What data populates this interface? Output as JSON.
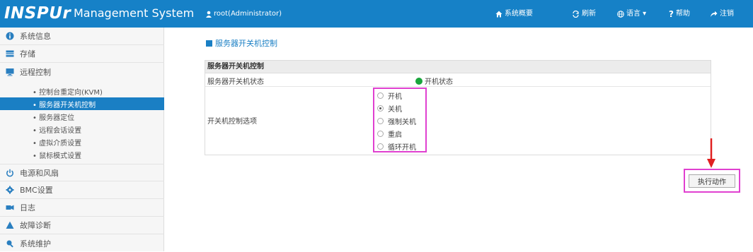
{
  "app": {
    "logo": "INSPUr",
    "title": "Management System",
    "user": "root(Administrator)"
  },
  "topnav": {
    "overview": "系统概要",
    "refresh": "刷新",
    "language": "语言 ▾",
    "help": "帮助",
    "logout": "注销"
  },
  "sidebar": {
    "items": [
      {
        "label": "系统信息",
        "icon": "info-icon"
      },
      {
        "label": "存储",
        "icon": "storage-icon"
      },
      {
        "label": "远程控制",
        "icon": "monitor-icon"
      }
    ],
    "sub_items": [
      {
        "label": "控制台重定向(KVM)",
        "active": false
      },
      {
        "label": "服务器开关机控制",
        "active": true
      },
      {
        "label": "服务器定位",
        "active": false
      },
      {
        "label": "远程会话设置",
        "active": false
      },
      {
        "label": "虚拟介质设置",
        "active": false
      },
      {
        "label": "鼠标模式设置",
        "active": false
      }
    ],
    "items_after": [
      {
        "label": "电源和风扇",
        "icon": "power-icon"
      },
      {
        "label": "BMC设置",
        "icon": "gear-icon"
      },
      {
        "label": "日志",
        "icon": "log-icon"
      },
      {
        "label": "故障诊断",
        "icon": "warning-icon"
      },
      {
        "label": "系统维护",
        "icon": "maintenance-icon"
      }
    ]
  },
  "main": {
    "page_title": "服务器开关机控制",
    "panel_title": "服务器开关机控制",
    "status_label": "服务器开关机状态",
    "status_value": "开机状态",
    "status_color": "#19a53c",
    "control_label": "开关机控制选项",
    "options": [
      {
        "label": "开机",
        "selected": false
      },
      {
        "label": "关机",
        "selected": true
      },
      {
        "label": "强制关机",
        "selected": false
      },
      {
        "label": "重启",
        "selected": false
      },
      {
        "label": "循环开机",
        "selected": false
      }
    ],
    "execute_button": "执行动作"
  },
  "colors": {
    "topbar": "#1681c7",
    "highlight": "#e040d0",
    "arrow": "#e02020"
  }
}
